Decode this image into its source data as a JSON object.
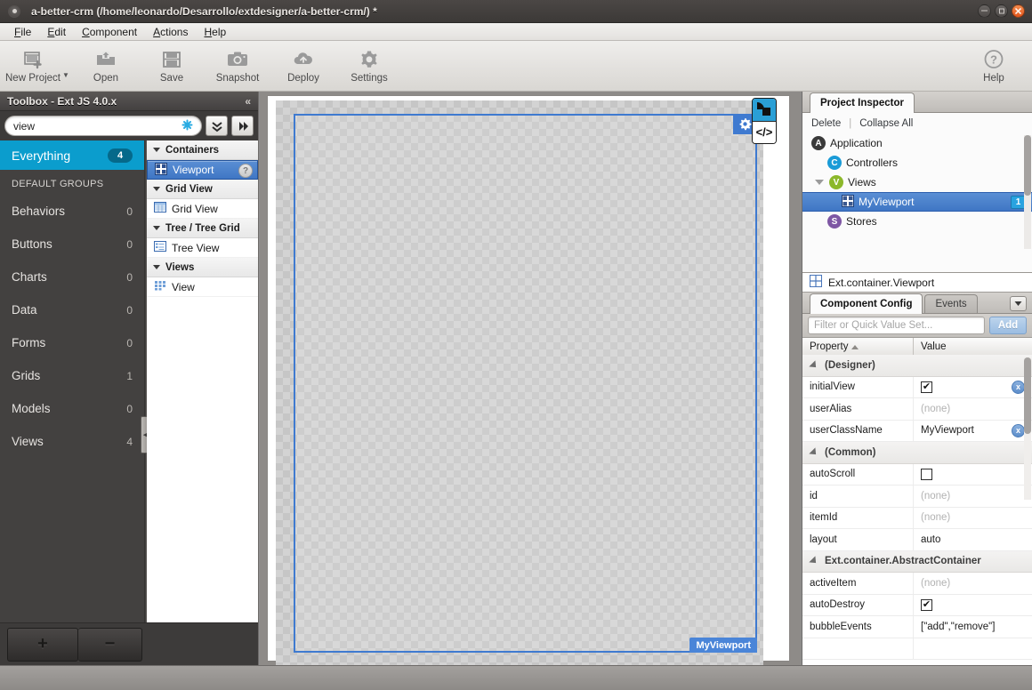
{
  "window": {
    "title": "a-better-crm (/home/leonardo/Desarrollo/extdesigner/a-better-crm/) *",
    "minimize_label": "–",
    "maximize_label": "□",
    "close_label": "×"
  },
  "menubar": [
    {
      "label": "File",
      "mnemonic": "F"
    },
    {
      "label": "Edit",
      "mnemonic": "E"
    },
    {
      "label": "Component",
      "mnemonic": "C"
    },
    {
      "label": "Actions",
      "mnemonic": "A"
    },
    {
      "label": "Help",
      "mnemonic": "H"
    }
  ],
  "toolbar": [
    {
      "label": "New Project",
      "icon": "new-project-icon"
    },
    {
      "label": "Open",
      "icon": "open-folder-icon"
    },
    {
      "label": "Save",
      "icon": "save-disk-icon"
    },
    {
      "label": "Snapshot",
      "icon": "camera-icon"
    },
    {
      "label": "Deploy",
      "icon": "cloud-upload-icon"
    },
    {
      "label": "Settings",
      "icon": "gear-icon"
    },
    {
      "label": "Help",
      "icon": "question-circle-icon"
    }
  ],
  "toolbox": {
    "title": "Toolbox - Ext JS 4.0.x",
    "collapse_label": "«",
    "search": {
      "value": "view",
      "placeholder": "",
      "clear_label": "✖"
    },
    "everything": {
      "label": "Everything",
      "count": "4"
    },
    "default_groups_label": "DEFAULT GROUPS",
    "groups": [
      {
        "label": "Behaviors",
        "count": "0"
      },
      {
        "label": "Buttons",
        "count": "0"
      },
      {
        "label": "Charts",
        "count": "0"
      },
      {
        "label": "Data",
        "count": "0"
      },
      {
        "label": "Forms",
        "count": "0"
      },
      {
        "label": "Grids",
        "count": "1"
      },
      {
        "label": "Models",
        "count": "0"
      },
      {
        "label": "Views",
        "count": "4"
      }
    ],
    "components": [
      {
        "type": "group",
        "label": "Containers"
      },
      {
        "type": "item",
        "label": "Viewport",
        "selected": true,
        "badge": "?"
      },
      {
        "type": "group",
        "label": "Grid View"
      },
      {
        "type": "item",
        "label": "Grid View",
        "selected": false
      },
      {
        "type": "group",
        "label": "Tree / Tree Grid"
      },
      {
        "type": "item",
        "label": "Tree View",
        "selected": false
      },
      {
        "type": "group",
        "label": "Views"
      },
      {
        "type": "item",
        "label": "View",
        "selected": false
      }
    ],
    "footer": {
      "add_label": "+",
      "remove_label": "−"
    }
  },
  "canvas": {
    "viewport_tag": "MyViewport",
    "gear_icon": "gear-icon",
    "mode_design": "design-mode-icon",
    "mode_code": "</>"
  },
  "inspector": {
    "tab_label": "Project Inspector",
    "delete_label": "Delete",
    "collapse_all_label": "Collapse All",
    "tree": [
      {
        "label": "Application",
        "badge": "A",
        "badge_class": "a",
        "indent": 0,
        "selected": false,
        "count": null,
        "disclosure": false
      },
      {
        "label": "Controllers",
        "badge": "C",
        "badge_class": "c",
        "indent": 1,
        "selected": false,
        "count": null,
        "disclosure": false
      },
      {
        "label": "Views",
        "badge": "V",
        "badge_class": "v",
        "indent": 1,
        "selected": false,
        "count": null,
        "disclosure": true
      },
      {
        "label": "MyViewport",
        "badge": "",
        "badge_class": "vp",
        "indent": 2,
        "selected": true,
        "count": "1",
        "disclosure": false
      },
      {
        "label": "Stores",
        "badge": "S",
        "badge_class": "s",
        "indent": 1,
        "selected": false,
        "count": null,
        "disclosure": false
      }
    ],
    "class_name": "Ext.container.Viewport"
  },
  "config_panel": {
    "tabs": [
      {
        "label": "Component Config",
        "active": true
      },
      {
        "label": "Events",
        "active": false
      }
    ],
    "menu_button": "▼",
    "filter_placeholder": "Filter or Quick Value Set...",
    "filter_value": "",
    "add_label": "Add",
    "columns": {
      "property": "Property",
      "value": "Value",
      "sort": "ascending"
    },
    "rows": [
      {
        "kind": "group",
        "property": "(Designer)"
      },
      {
        "kind": "row",
        "property": "initialView",
        "value": "",
        "value_type": "checkbox-checked",
        "clearable": true
      },
      {
        "kind": "row",
        "property": "userAlias",
        "value": "(none)",
        "value_type": "none",
        "clearable": false
      },
      {
        "kind": "row",
        "property": "userClassName",
        "value": "MyViewport",
        "value_type": "text",
        "clearable": true
      },
      {
        "kind": "group",
        "property": "(Common)"
      },
      {
        "kind": "row",
        "property": "autoScroll",
        "value": "",
        "value_type": "checkbox-unchecked",
        "clearable": false
      },
      {
        "kind": "row",
        "property": "id",
        "value": "(none)",
        "value_type": "none",
        "clearable": false
      },
      {
        "kind": "row",
        "property": "itemId",
        "value": "(none)",
        "value_type": "none",
        "clearable": false
      },
      {
        "kind": "row",
        "property": "layout",
        "value": "auto",
        "value_type": "text",
        "clearable": false
      },
      {
        "kind": "group",
        "property": "Ext.container.AbstractContainer"
      },
      {
        "kind": "row",
        "property": "activeItem",
        "value": "(none)",
        "value_type": "none",
        "clearable": false
      },
      {
        "kind": "row",
        "property": "autoDestroy",
        "value": "",
        "value_type": "checkbox-checked",
        "clearable": false
      },
      {
        "kind": "row",
        "property": "bubbleEvents",
        "value": "[\"add\",\"remove\"]",
        "value_type": "text",
        "clearable": false
      }
    ]
  },
  "colors": {
    "accent_blue": "#3f76c4",
    "toolbox_cyan": "#0b9dcd",
    "chrome_dark": "#3d3b3a",
    "close_orange": "#e2561d"
  }
}
